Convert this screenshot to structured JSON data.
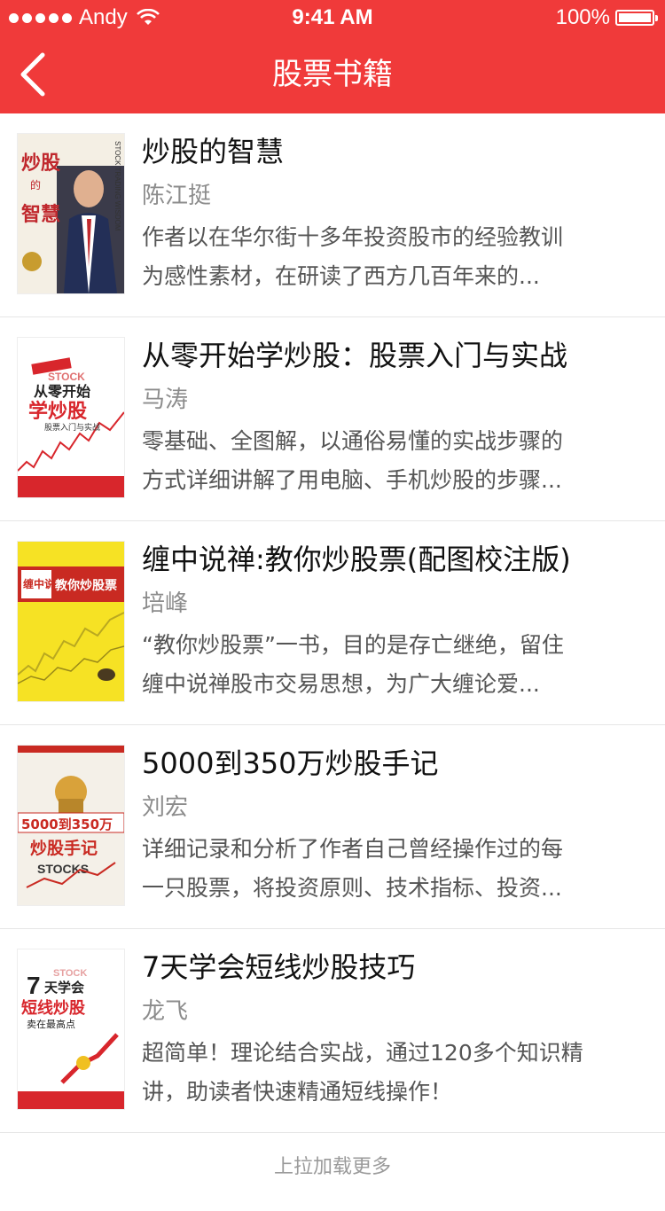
{
  "status_bar": {
    "carrier": "Andy",
    "time": "9:41 AM",
    "battery": "100%",
    "battery_level": 1.0
  },
  "nav": {
    "title": "股票书籍",
    "back_icon": "chevron-left-icon"
  },
  "books": [
    {
      "title": "炒股的智慧",
      "author": "陈江挺",
      "desc_line1": "作者以在华尔街十多年投资股市的经验教训",
      "desc_line2": "为感性素材，在研读了西方几百年来的...",
      "cover": {
        "text1": "炒股",
        "text2": "的",
        "text3": "智慧",
        "side": "STOCK TRADING WISDOM"
      }
    },
    {
      "title": "从零开始学炒股：股票入门与实战",
      "author": "马涛",
      "desc_line1": "零基础、全图解，以通俗易懂的实战步骤的",
      "desc_line2": "方式详细讲解了用电脑、手机炒股的步骤...",
      "cover": {
        "text1": "STOCK",
        "text2": "从零开始",
        "text3": "学炒股",
        "text4": "股票入门与实战"
      }
    },
    {
      "title": "缠中说禅:教你炒股票(配图校注版)",
      "author": "培峰",
      "desc_line1": "“教你炒股票”一书，目的是存亡继绝，留住",
      "desc_line2": "缠中说禅股市交易思想，为广大缠论爱...",
      "cover": {
        "text1": "缠中说禅",
        "text2": "教你炒股票"
      }
    },
    {
      "title": "5000到350万炒股手记",
      "author": "刘宏",
      "desc_line1": "详细记录和分析了作者自己曾经操作过的每",
      "desc_line2": "一只股票，将投资原则、技术指标、投资...",
      "cover": {
        "text1": "5000到350万",
        "text2": "炒股手记",
        "text3": "STOCKS"
      }
    },
    {
      "title": "7天学会短线炒股技巧",
      "author": "龙飞",
      "desc_line1": "超简单！理论结合实战，通过120多个知识精",
      "desc_line2": "讲，助读者快速精通短线操作！",
      "cover": {
        "text1": "7",
        "text2": "天学会",
        "text3": "短线炒股",
        "text4": "卖在最高点",
        "text5": "STOCK"
      }
    }
  ],
  "footer": {
    "load_more": "上拉加载更多"
  },
  "colors": {
    "accent": "#f03a3a",
    "title": "#111111",
    "author": "#8c8c8c",
    "desc": "#555555"
  }
}
